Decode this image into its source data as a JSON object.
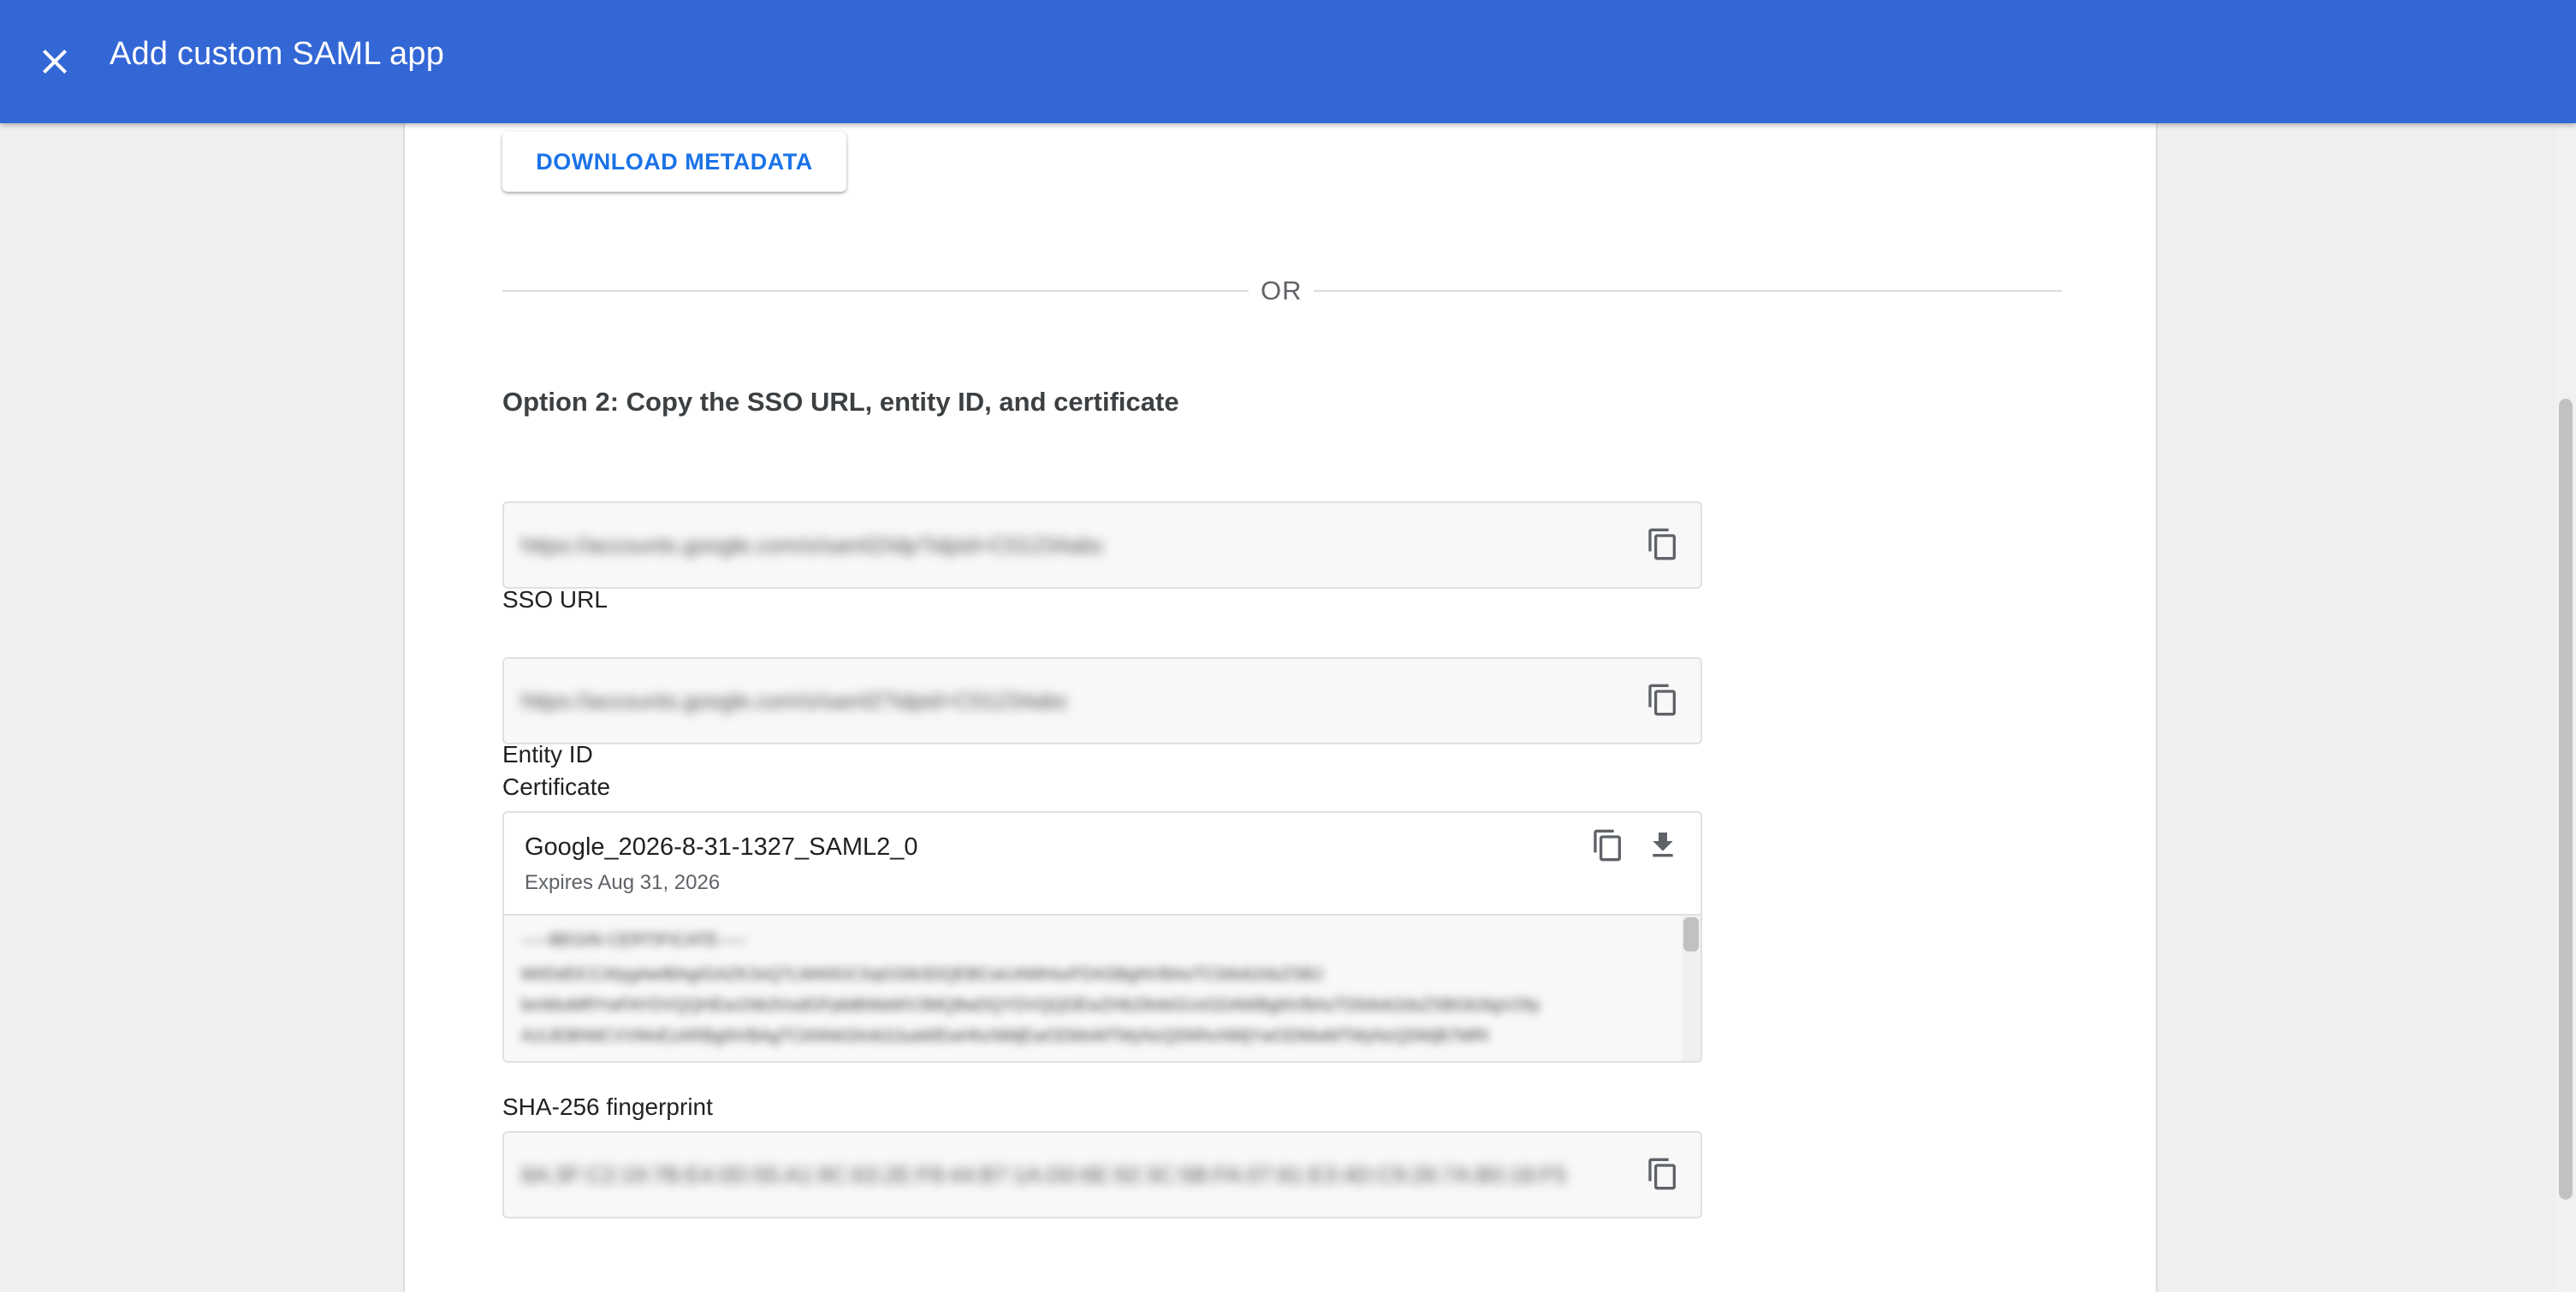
{
  "header": {
    "title": "Add custom SAML app",
    "close_icon": "close-icon"
  },
  "buttons": {
    "download_metadata": "DOWNLOAD METADATA"
  },
  "divider": {
    "text": "OR"
  },
  "option2": {
    "title": "Option 2: Copy the SSO URL, entity ID, and certificate"
  },
  "fields": {
    "sso_url": {
      "label": "SSO URL",
      "value": "https://accounts.google.com/o/saml2/idp?idpid=C01234abc"
    },
    "entity_id": {
      "label": "Entity ID",
      "value": "https://accounts.google.com/o/saml2?idpid=C01234abc"
    },
    "certificate": {
      "label": "Certificate",
      "name": "Google_2026-8-31-1327_SAML2_0",
      "expires": "Expires Aug 31, 2026",
      "body_lines": [
        "-----BEGIN CERTIFICATE-----",
        "MIIDdDCCAlygAwIBAgIGAZK3xQ7LMA0GCSqGSIb3DQEBCwUAMHsxFDASBgNVBAoTC0dvb2dsZSBJ",
        "bmMuMRYwFAYDVQQHEw1Nb3VudGFpbiBWaWV3MQ8wDQYDVQQDEwZHb29nbGUxGDAWBgNVBAsTD0dvb2dsZSBGb3IgV29yazELMAkG",
        "A1UEBhMCVVMxEzARBgNVBAgTCkNhbGlmb3JuaWEwHhcNMjEwODMxMTMyNzQ0WhcNMjYwODMwMTMyNzQ0WjB7MRQwEgYD"
      ]
    },
    "sha256": {
      "label": "SHA-256 fingerprint",
      "value": "8A:3F:C2:19:7B:E4:0D:55:A1:9C:63:2E:F8:44:B7:1A:D0:6E:92:3C:5B:FA:07:81:E3:4D:C9:26:7A:B0:18:F5"
    }
  },
  "icons": {
    "copy": "copy-icon",
    "download": "download-icon"
  }
}
